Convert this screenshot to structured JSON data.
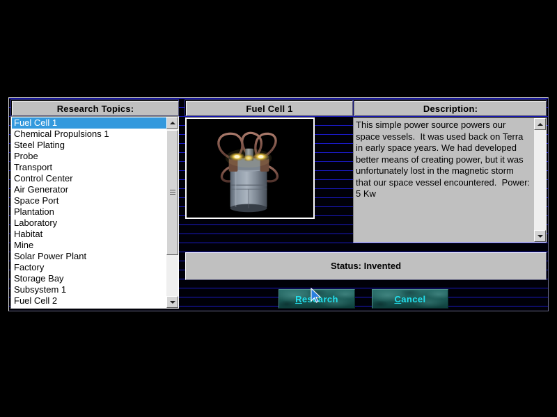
{
  "window": {
    "background_color": "#000000",
    "scanline_color": "#1a1ac8"
  },
  "panels": {
    "topics_caption": "Research Topics:",
    "item_caption": "Fuel Cell 1",
    "description_caption": "Description:"
  },
  "topics": {
    "selected_index": 0,
    "items": [
      {
        "label": "Fuel Cell 1"
      },
      {
        "label": "Chemical Propulsions 1"
      },
      {
        "label": "Steel Plating"
      },
      {
        "label": "Probe"
      },
      {
        "label": "Transport"
      },
      {
        "label": "Control Center"
      },
      {
        "label": "Air Generator"
      },
      {
        "label": "Space Port"
      },
      {
        "label": "Plantation"
      },
      {
        "label": "Laboratory"
      },
      {
        "label": "Habitat"
      },
      {
        "label": "Mine"
      },
      {
        "label": "Solar Power Plant"
      },
      {
        "label": "Factory"
      },
      {
        "label": "Storage Bay"
      },
      {
        "label": "Subsystem 1"
      },
      {
        "label": "Fuel Cell 2"
      }
    ],
    "selection_color": "#3399dd",
    "selection_text_color": "#ffffff"
  },
  "preview": {
    "alt": "fuel-cell-render",
    "background_color": "#000000"
  },
  "description": {
    "text": "This simple power source powers our space vessels.  It was used back on Terra in early space years. We had developed better means of creating power, but it was unfortunately lost in the magnetic storm that our space vessel encountered.  Power: 5 Kw"
  },
  "status": {
    "text": "Status: Invented"
  },
  "buttons": {
    "research": {
      "label": "Research",
      "accel": "R",
      "color": "#22e0ee"
    },
    "cancel": {
      "label": "Cancel",
      "accel": "C",
      "color": "#22e0ee"
    }
  },
  "scrollbars": {
    "topics": {
      "up_icon": "arrow-up-icon",
      "down_icon": "arrow-down-icon",
      "thumb_icon": "grip-icon"
    },
    "description": {
      "up_icon": "arrow-up-icon",
      "down_icon": "arrow-down-icon"
    }
  },
  "cursor": {
    "icon": "arrow-cursor",
    "color": "#2a7fe0"
  }
}
